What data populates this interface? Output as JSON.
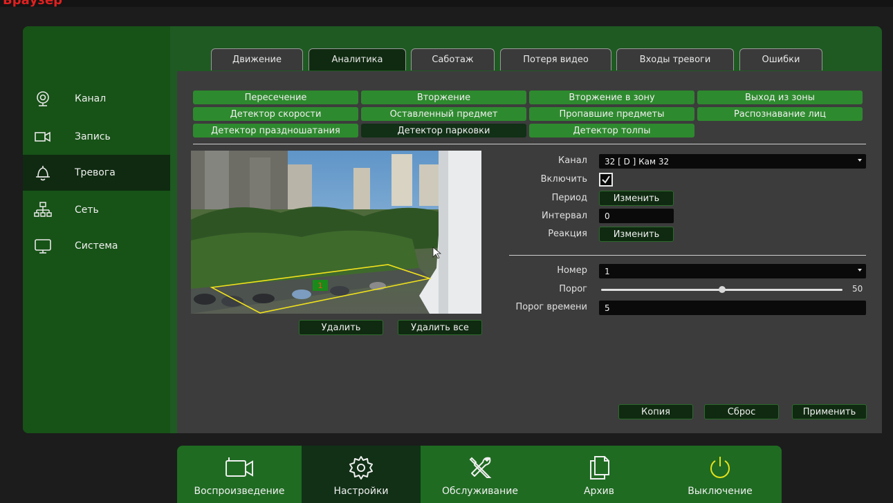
{
  "header": {
    "title": "Браузер"
  },
  "sidebar": {
    "items": [
      {
        "label": "Канал",
        "icon": "camera-lens-icon",
        "active": false
      },
      {
        "label": "Запись",
        "icon": "video-record-icon",
        "active": false
      },
      {
        "label": "Тревога",
        "icon": "bell-icon",
        "active": true
      },
      {
        "label": "Сеть",
        "icon": "network-icon",
        "active": false
      },
      {
        "label": "Система",
        "icon": "monitor-icon",
        "active": false
      }
    ]
  },
  "tabs": [
    {
      "label": "Движение",
      "active": false
    },
    {
      "label": "Аналитика",
      "active": true
    },
    {
      "label": "Саботаж",
      "active": false
    },
    {
      "label": "Потеря видео",
      "active": false
    },
    {
      "label": "Входы тревоги",
      "active": false
    },
    {
      "label": "Ошибки",
      "active": false
    }
  ],
  "analytics": [
    {
      "label": "Пересечение",
      "active": false
    },
    {
      "label": "Вторжение",
      "active": false
    },
    {
      "label": "Вторжение в зону",
      "active": false
    },
    {
      "label": "Выход из зоны",
      "active": false
    },
    {
      "label": "Детектор скорости",
      "active": false
    },
    {
      "label": "Оставленный предмет",
      "active": false
    },
    {
      "label": "Пропавшие предметы",
      "active": false
    },
    {
      "label": "Распознавание лиц",
      "active": false
    },
    {
      "label": "Детектор праздношатания",
      "active": false
    },
    {
      "label": "Детектор парковки",
      "active": true
    },
    {
      "label": "Детектор толпы",
      "active": false
    }
  ],
  "video": {
    "zone_number": "1"
  },
  "video_buttons": {
    "delete": "Удалить",
    "delete_all": "Удалить все"
  },
  "form": {
    "channel_label": "Канал",
    "channel_value": "32 [ D ] Кам 32",
    "enable_label": "Включить",
    "enable_checked": true,
    "period_label": "Период",
    "period_button": "Изменить",
    "interval_label": "Интервал",
    "interval_value": "0",
    "reaction_label": "Реакция",
    "reaction_button": "Изменить",
    "number_label": "Номер",
    "number_value": "1",
    "threshold_label": "Порог",
    "threshold_value": "50",
    "threshold_fraction": 0.5,
    "time_threshold_label": "Порог времени",
    "time_threshold_value": "5"
  },
  "actions": {
    "copy": "Копия",
    "reset": "Сброс",
    "apply": "Применить"
  },
  "dock": [
    {
      "label": "Воспроизведение",
      "icon": "playback-camera-icon",
      "active": false
    },
    {
      "label": "Настройки",
      "icon": "gear-icon",
      "active": true
    },
    {
      "label": "Обслуживание",
      "icon": "tools-icon",
      "active": false
    },
    {
      "label": "Архив",
      "icon": "archive-files-icon",
      "active": false
    },
    {
      "label": "Выключение",
      "icon": "power-icon",
      "active": false
    }
  ],
  "colors": {
    "panel_green": "#1e5a22",
    "button_green": "#2e8a2e",
    "dark_active": "#0f2a10",
    "zone_yellow": "#f2e21c",
    "power_yellow": "#e6e21a"
  }
}
